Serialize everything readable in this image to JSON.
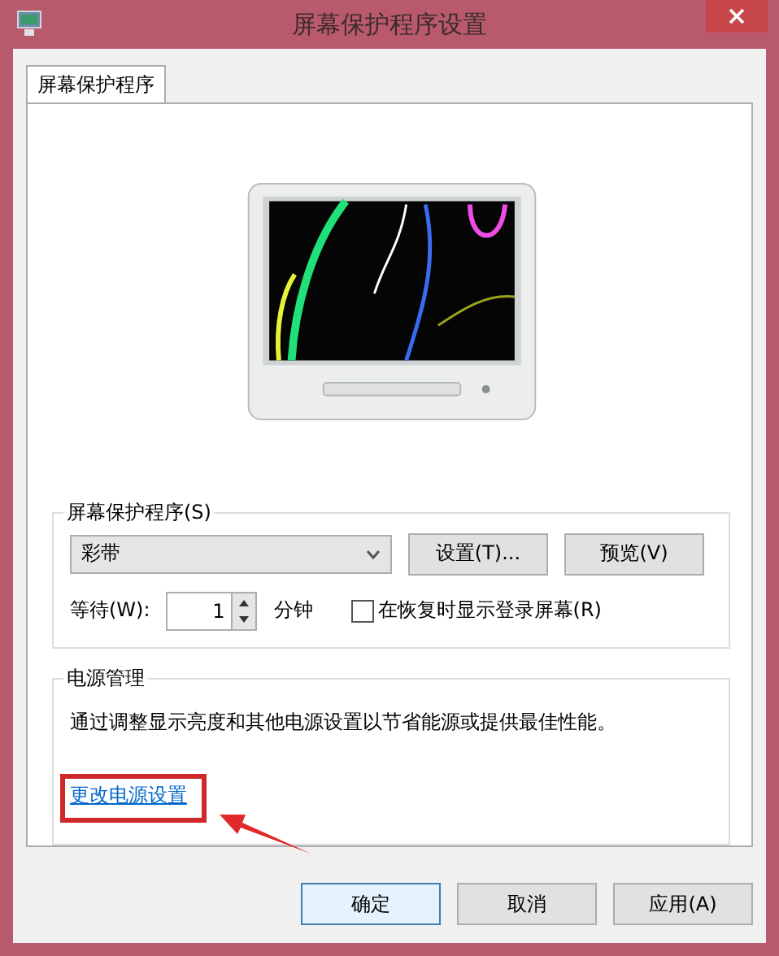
{
  "window": {
    "title": "屏幕保护程序设置"
  },
  "tabs": [
    {
      "label": "屏幕保护程序",
      "selected": true
    }
  ],
  "screen_saver": {
    "group_title": "屏幕保护程序(S)",
    "choice": "彩带",
    "settings_button": "设置(T)...",
    "preview_button": "预览(V)",
    "wait_label": "等待(W):",
    "wait_value": "1",
    "wait_unit": "分钟",
    "logon_checkbox": {
      "label": "在恢复时显示登录屏幕(R)",
      "checked": false
    }
  },
  "power": {
    "group_title": "电源管理",
    "description": "通过调整显示亮度和其他电源设置以节省能源或提供最佳性能。",
    "link": "更改电源设置"
  },
  "buttons": [
    {
      "label": "确定",
      "default": true
    },
    {
      "label": "取消",
      "default": false
    },
    {
      "label": "应用(A)",
      "default": false
    }
  ]
}
